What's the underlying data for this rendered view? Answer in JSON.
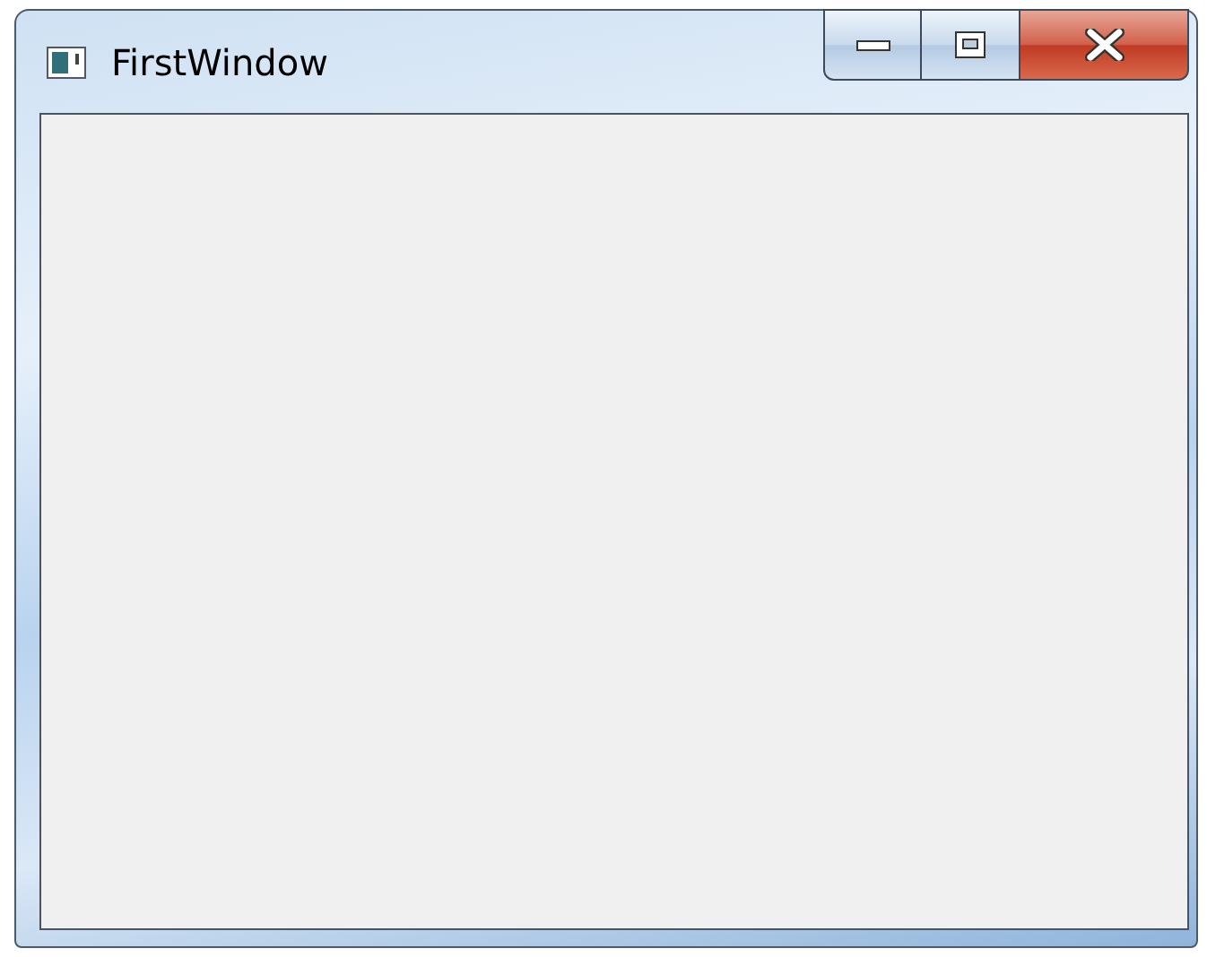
{
  "window": {
    "title": "FirstWindow"
  }
}
